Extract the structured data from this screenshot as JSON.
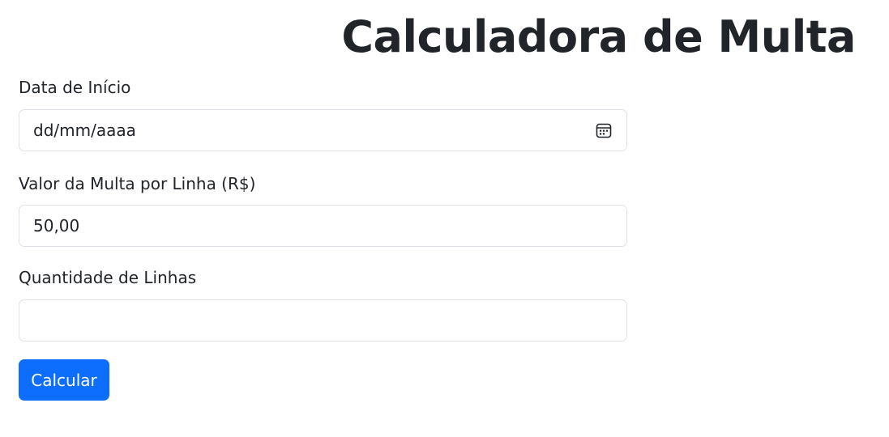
{
  "page": {
    "title": "Calculadora de Multa"
  },
  "form": {
    "start_date": {
      "label": "Data de Início",
      "placeholder": "dd/mm/aaaa",
      "icon": "calendar-icon"
    },
    "fine_value": {
      "label": "Valor da Multa por Linha (R$)",
      "value": "50,00"
    },
    "line_count": {
      "label": "Quantidade de Linhas",
      "value": ""
    },
    "submit_label": "Calcular"
  },
  "colors": {
    "primary": "#0d6efd",
    "text": "#212529",
    "border": "#dee2e6"
  }
}
